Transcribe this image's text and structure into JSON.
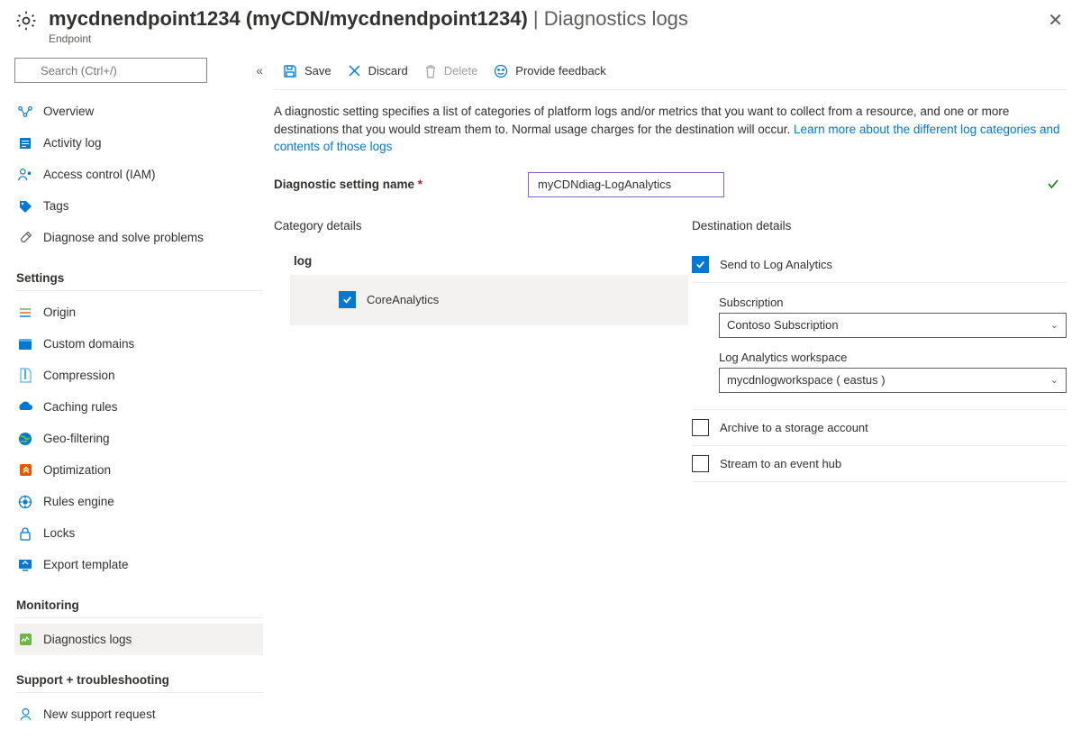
{
  "header": {
    "title_bold": "mycdnendpoint1234 (myCDN/mycdnendpoint1234)",
    "title_thin": " | Diagnostics logs",
    "subtitle": "Endpoint"
  },
  "search": {
    "placeholder": "Search (Ctrl+/)"
  },
  "nav": {
    "top": [
      {
        "label": "Overview"
      },
      {
        "label": "Activity log"
      },
      {
        "label": "Access control (IAM)"
      },
      {
        "label": "Tags"
      },
      {
        "label": "Diagnose and solve problems"
      }
    ],
    "section_settings": "Settings",
    "settings": [
      {
        "label": "Origin"
      },
      {
        "label": "Custom domains"
      },
      {
        "label": "Compression"
      },
      {
        "label": "Caching rules"
      },
      {
        "label": "Geo-filtering"
      },
      {
        "label": "Optimization"
      },
      {
        "label": "Rules engine"
      },
      {
        "label": "Locks"
      },
      {
        "label": "Export template"
      }
    ],
    "section_monitoring": "Monitoring",
    "monitoring": [
      {
        "label": "Diagnostics logs",
        "active": true
      }
    ],
    "section_support": "Support + troubleshooting",
    "support": [
      {
        "label": "New support request"
      }
    ]
  },
  "toolbar": {
    "save": "Save",
    "discard": "Discard",
    "delete": "Delete",
    "feedback": "Provide feedback"
  },
  "description": {
    "text": "A diagnostic setting specifies a list of categories of platform logs and/or metrics that you want to collect from a resource, and one or more destinations that you would stream them to. Normal usage charges for the destination will occur. ",
    "link": "Learn more about the different log categories and contents of those logs"
  },
  "form": {
    "setting_name_label": "Diagnostic setting name",
    "setting_name_value": "myCDNdiag-LogAnalytics"
  },
  "category": {
    "header": "Category details",
    "log_header": "log",
    "items": [
      {
        "label": "CoreAnalytics",
        "checked": true
      }
    ]
  },
  "destination": {
    "header": "Destination details",
    "send_log_analytics": {
      "label": "Send to Log Analytics",
      "checked": true
    },
    "subscription_label": "Subscription",
    "subscription_value": "Contoso Subscription",
    "workspace_label": "Log Analytics workspace",
    "workspace_value": "mycdnlogworkspace ( eastus )",
    "archive_storage": {
      "label": "Archive to a storage account",
      "checked": false
    },
    "stream_eventhub": {
      "label": "Stream to an event hub",
      "checked": false
    }
  }
}
